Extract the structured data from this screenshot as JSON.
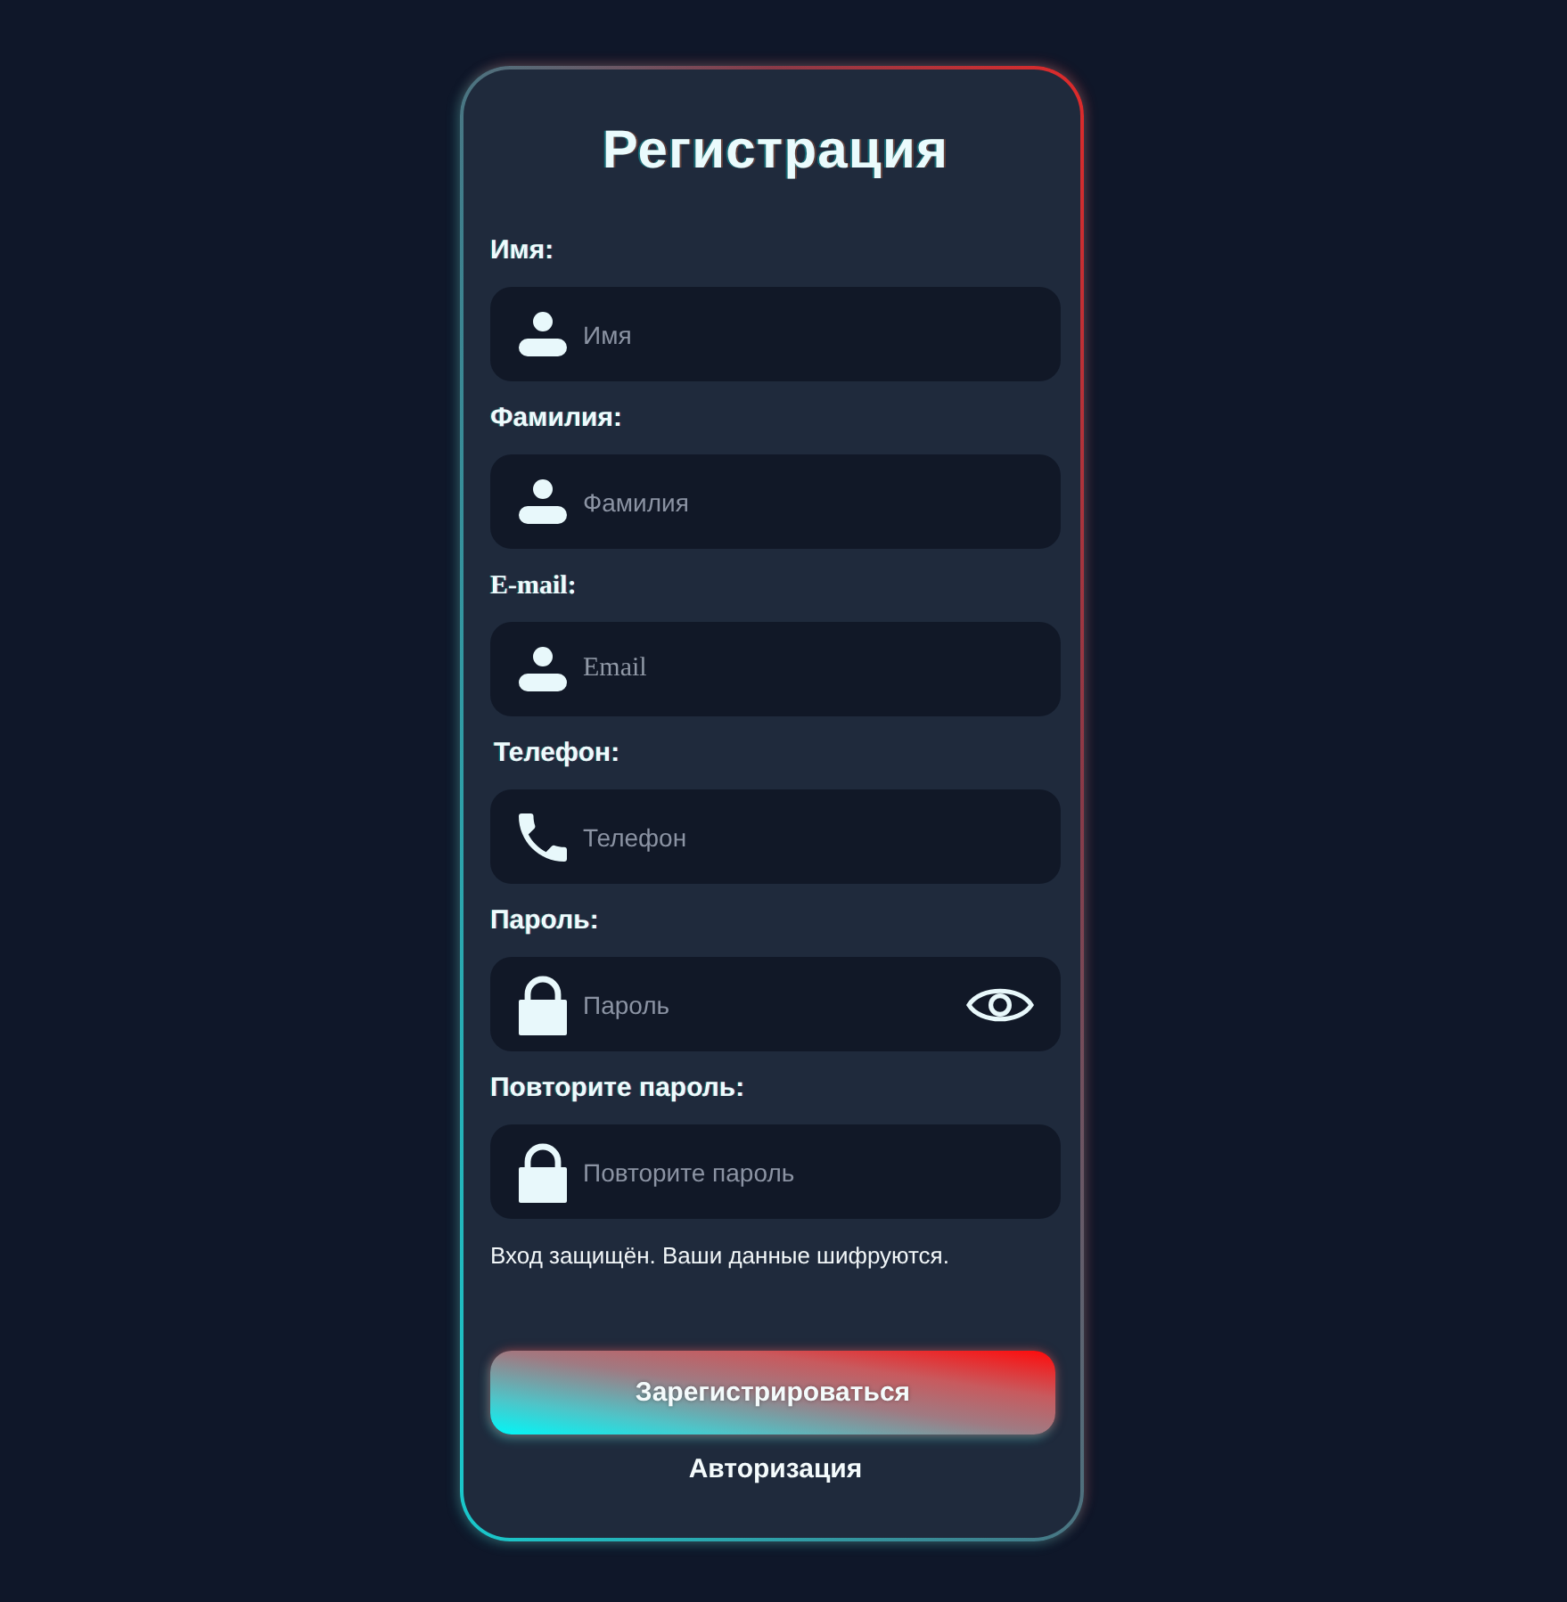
{
  "title": "Регистрация",
  "fields": [
    {
      "kind": "name",
      "label": "Имя:",
      "placeholder": "Имя",
      "reveal_toggle": false
    },
    {
      "kind": "name",
      "label": "Фамилия:",
      "placeholder": "Фамилия",
      "reveal_toggle": false
    },
    {
      "kind": "email",
      "label": "E-mail:",
      "placeholder": "Email",
      "reveal_toggle": false
    },
    {
      "kind": "phone",
      "label": "Телефон:",
      "placeholder": "Телефон",
      "reveal_toggle": false
    },
    {
      "kind": "password",
      "label": "Пароль:",
      "placeholder": "Пароль",
      "reveal_toggle": true
    },
    {
      "kind": "password",
      "label": "Повторите пароль:",
      "placeholder": "Повторите пароль",
      "reveal_toggle": false
    }
  ],
  "note": "Вход защищён. Ваши данные шифруются.",
  "submit_button": "Зарегистрироваться",
  "login_link": "Авторизация"
}
